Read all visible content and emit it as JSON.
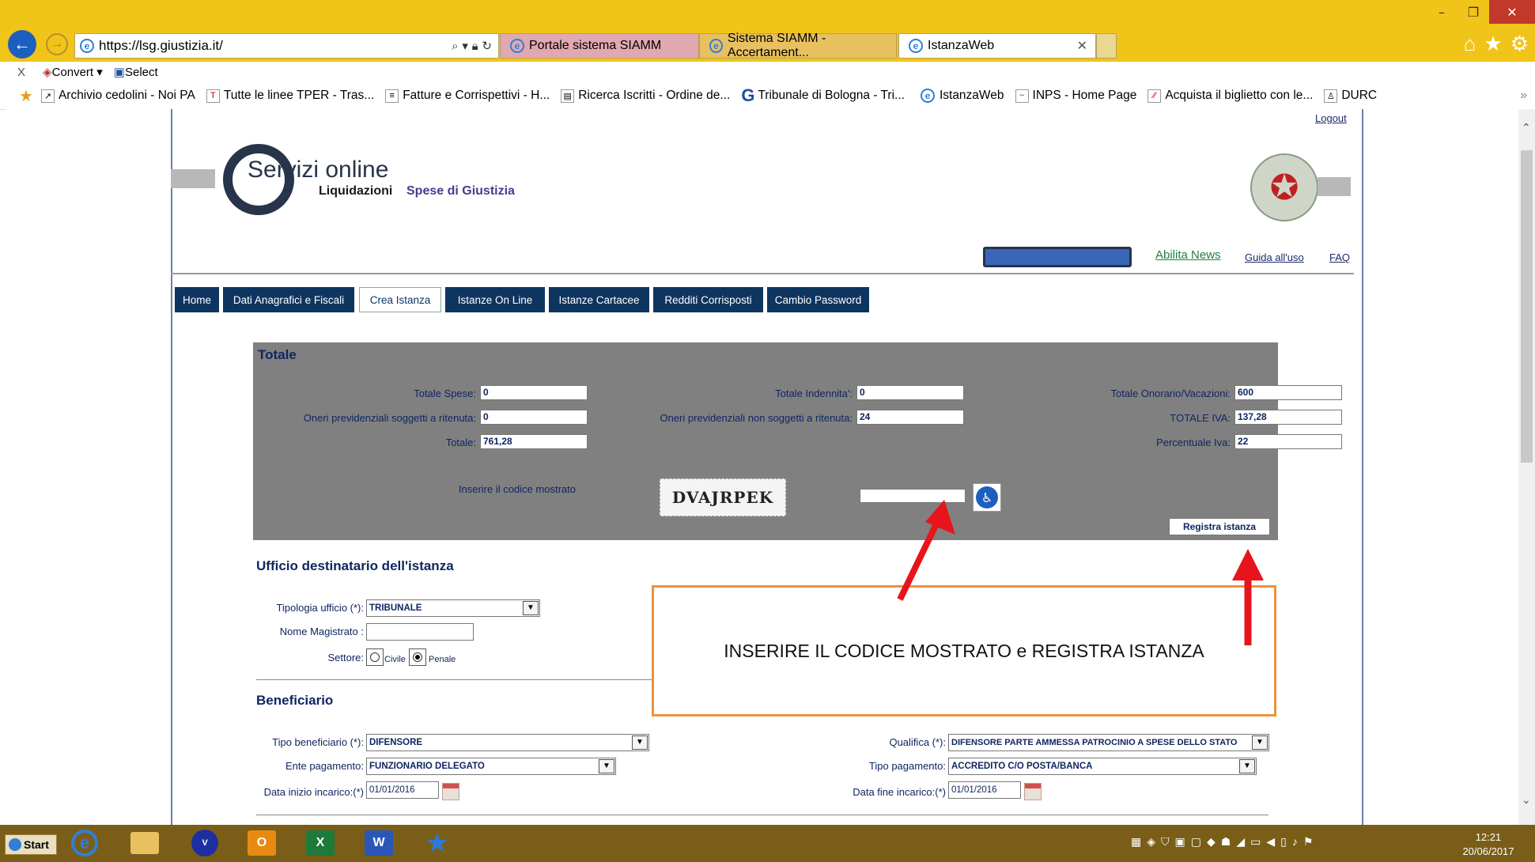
{
  "browser": {
    "url": "https://lsg.giustizia.it/",
    "tabs": [
      {
        "label": "Portale sistema SIAMM"
      },
      {
        "label": "Sistema SIAMM - Accertament..."
      },
      {
        "label": "IstanzaWeb"
      }
    ],
    "command_bar": {
      "convert": "Convert",
      "select": "Select",
      "close_x": "X"
    },
    "favorites": [
      "Archivio cedolini - Noi PA",
      "Tutte le linee  TPER - Tras...",
      "Fatture e Corrispettivi - H...",
      "Ricerca Iscritti - Ordine de...",
      "Tribunale di Bologna - Tri...",
      "IstanzaWeb",
      "INPS - Home Page",
      "Acquista il biglietto con le...",
      "DURC"
    ]
  },
  "header": {
    "logout": "Logout",
    "logo_servizi": "Servizi online",
    "logo_liquidazioni": "Liquidazioni",
    "logo_spese": "Spese di Giustizia",
    "links": {
      "abilita_news": "Abilita News",
      "guida": "Guida all'uso",
      "faq": "FAQ"
    }
  },
  "nav": {
    "items": [
      "Home",
      "Dati Anagrafici e Fiscali",
      "Crea Istanza",
      "Istanze On Line",
      "Istanze Cartacee",
      "Redditi Corrisposti",
      "Cambio Password"
    ],
    "active": "Crea Istanza"
  },
  "totale": {
    "title": "Totale",
    "fields": {
      "totale_spese": {
        "label": "Totale Spese:",
        "value": "0"
      },
      "totale_indennita": {
        "label": "Totale Indennita':",
        "value": "0"
      },
      "totale_onorario": {
        "label": "Totale Onorario/Vacazioni:",
        "value": "600"
      },
      "oneri_soggetti": {
        "label": "Oneri previdenziali soggetti a ritenuta:",
        "value": "0"
      },
      "oneri_non_soggetti": {
        "label": "Oneri previdenziali non soggetti a ritenuta:",
        "value": "24"
      },
      "totale_iva": {
        "label": "TOTALE IVA:",
        "value": "137,28"
      },
      "totale": {
        "label": "Totale:",
        "value": "761,28"
      },
      "percentuale_iva": {
        "label": "Percentuale Iva:",
        "value": "22"
      }
    },
    "captcha_label": "Inserire il codice mostrato",
    "captcha_text": "DVAJRPEK",
    "captcha_input": "",
    "registra_button": "Registra istanza"
  },
  "ufficio": {
    "title": "Ufficio destinatario dell'istanza",
    "tipologia_label": "Tipologia ufficio (*):",
    "tipologia_value": "TRIBUNALE",
    "magistrato_label": "Nome Magistrato :",
    "magistrato_value": "",
    "settore_label": "Settore:",
    "settore_civile": "Civile",
    "settore_penale": "Penale",
    "settore_selected": "Penale"
  },
  "annotation": {
    "text": "INSERIRE IL CODICE MOSTRATO e REGISTRA ISTANZA",
    "border_color": "#f0903a",
    "arrow_color": "#e8141b"
  },
  "beneficiario": {
    "title": "Beneficiario",
    "tipo_label": "Tipo beneficiario (*):",
    "tipo_value": "DIFENSORE",
    "ente_label": "Ente pagamento:",
    "ente_value": "FUNZIONARIO DELEGATO",
    "inizio_label": "Data inizio incarico:(*)",
    "inizio_value": "01/01/2016",
    "qualifica_label": "Qualifica (*):",
    "qualifica_value": "DIFENSORE PARTE AMMESSA PATROCINIO A SPESE DELLO STATO",
    "tipo_pag_label": "Tipo pagamento:",
    "tipo_pag_value": "ACCREDITO C/O POSTA/BANCA",
    "fine_label": "Data fine incarico:(*)",
    "fine_value": "01/01/2016"
  },
  "taskbar": {
    "start": "Start",
    "time": "12:21",
    "date": "20/06/2017"
  },
  "colors": {
    "title_bar": "#f0c419",
    "nav_blue": "#0e3560",
    "panel_gray": "#808080",
    "taskbar": "#7a5e18"
  }
}
